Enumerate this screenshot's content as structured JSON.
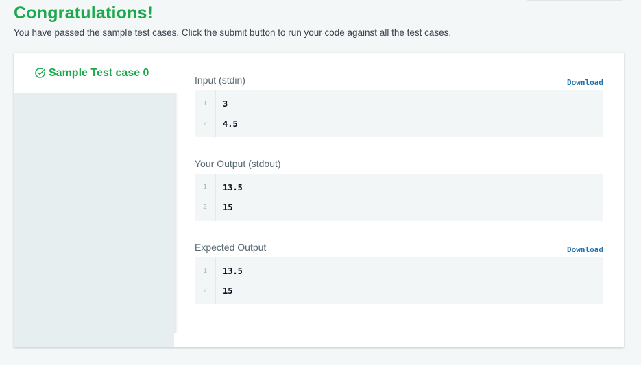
{
  "header": {
    "title": "Congratulations!",
    "subtitle": "You have passed the sample test cases. Click the submit button to run your code against all the test cases."
  },
  "sidebar": {
    "tabs": [
      {
        "label": "Sample Test case 0",
        "icon": "check-circle-icon",
        "status": "passed"
      }
    ]
  },
  "sections": {
    "input": {
      "label": "Input (stdin)",
      "download_label": "Download",
      "lines": [
        {
          "num": "1",
          "text": "3"
        },
        {
          "num": "2",
          "text": "4.5"
        }
      ]
    },
    "output": {
      "label": "Your Output (stdout)",
      "lines": [
        {
          "num": "1",
          "text": "13.5"
        },
        {
          "num": "2",
          "text": "15"
        }
      ]
    },
    "expected": {
      "label": "Expected Output",
      "download_label": "Download",
      "lines": [
        {
          "num": "1",
          "text": "13.5"
        },
        {
          "num": "2",
          "text": "15"
        }
      ]
    }
  },
  "colors": {
    "success": "#1ba94c",
    "link": "#1f6fb1",
    "page_bg": "#f3f7f7",
    "code_bg": "#f3f6f7"
  }
}
